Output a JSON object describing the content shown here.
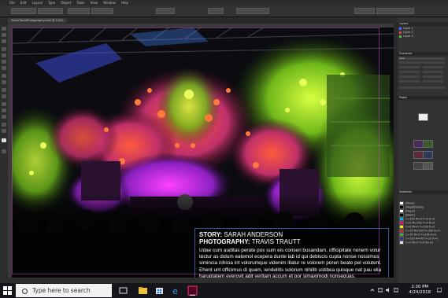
{
  "menubar": {
    "items": [
      "File",
      "Edit",
      "Layout",
      "Type",
      "Object",
      "Table",
      "View",
      "Window",
      "Help"
    ]
  },
  "document": {
    "tab_title": "TravisTrauttPhotography.indd @ 115%"
  },
  "article": {
    "story_label": "STORY:",
    "story_author": " SARAH ANDERSON",
    "photo_label": "PHOTOGRAPHY:",
    "photo_author": " TRAVIS TRAUTT",
    "body": "Udae cum auditas perate pos sum eis conseri busandam, officipitate nonem volur tectur as dolum eatemol ecepera dunte lab id qui debiscis cupta nonse nossimus simincia nihicia int volorumque videnim illatur re volorem poren beate pel volutent. Ehent unt officimus di quam, iendelitis solorum nihilib ustibea quisque nat pau elia haruptatem everovit adit veritam accum et por simaximodi nonsequas."
  },
  "panels": {
    "layers_title": "Layers",
    "layers": [
      {
        "name": "Layer 1",
        "color": "#3b78ff"
      },
      {
        "name": "Layer 2",
        "color": "#e04040"
      },
      {
        "name": "Layer 3",
        "color": "#40c040"
      }
    ],
    "character_title": "Character",
    "font_value": "Arial",
    "pages_title": "Pages",
    "swatches_title": "Swatches",
    "swatches": [
      {
        "name": "[None]",
        "color": "#ffffff"
      },
      {
        "name": "[Registration]",
        "color": "#000000"
      },
      {
        "name": "[Paper]",
        "color": "#ffffff"
      },
      {
        "name": "[Black]",
        "color": "#000000"
      },
      {
        "name": "C=100 M=0 Y=0 K=0",
        "color": "#00aeef"
      },
      {
        "name": "C=0 M=100 Y=0 K=0",
        "color": "#ec008c"
      },
      {
        "name": "C=0 M=0 Y=100 K=0",
        "color": "#fff200"
      },
      {
        "name": "C=15 M=100 Y=100 K=0",
        "color": "#d2232a"
      },
      {
        "name": "C=75 M=5 Y=100 K=0",
        "color": "#40ad48"
      },
      {
        "name": "C=100 M=90 Y=10 K=0",
        "color": "#2e3192"
      },
      {
        "name": "C=0 M=0 Y=0 K=10",
        "color": "#e6e6e6"
      }
    ]
  },
  "taskbar": {
    "search_placeholder": "Type here to search",
    "time": "2:30 PM",
    "date": "4/24/2018"
  }
}
